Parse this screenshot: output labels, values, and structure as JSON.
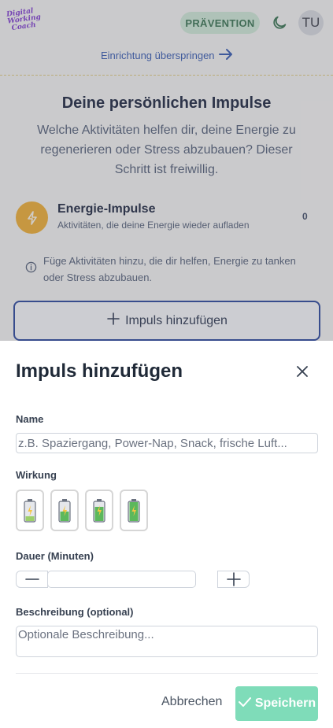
{
  "header": {
    "logo_lines": [
      "Digital",
      "Working",
      "Coach"
    ],
    "badge": "PRÄVENTION",
    "avatar_initials": "TU",
    "skip_link": "Einrichtung überspringen"
  },
  "main": {
    "title": "Deine persönlichen Impulse",
    "subtitle": "Welche Aktivitäten helfen dir, deine Energie zu regenerieren oder Stress abzubauen? Dieser Schritt ist freiwillig.",
    "section": {
      "title": "Energie-Impulse",
      "description": "Aktivitäten, die deine Energie wieder aufladen",
      "count": "0"
    },
    "info_text": "Füge Aktivitäten hinzu, die dir helfen, Energie zu tanken oder Stress abzubauen.",
    "add_button": "Impuls hinzufügen"
  },
  "sheet": {
    "title": "Impuls hinzufügen",
    "name_label": "Name",
    "name_placeholder": "z.B. Spaziergang, Power-Nap, Snack, frische Luft...",
    "effect_label": "Wirkung",
    "effect_levels": [
      0.25,
      0.5,
      0.75,
      1.0
    ],
    "duration_label": "Dauer (Minuten)",
    "duration_value": "",
    "description_label": "Beschreibung (optional)",
    "description_placeholder": "Optionale Beschreibung...",
    "cancel_button": "Abbrechen",
    "save_button": "Speichern"
  },
  "colors": {
    "badge_bg": "#cfe8c9",
    "accent_blue": "#1e3a8a",
    "energy_orange": "#f0a91a",
    "save_green": "#7fdcb9",
    "logo_purple": "#7a2fc2"
  }
}
